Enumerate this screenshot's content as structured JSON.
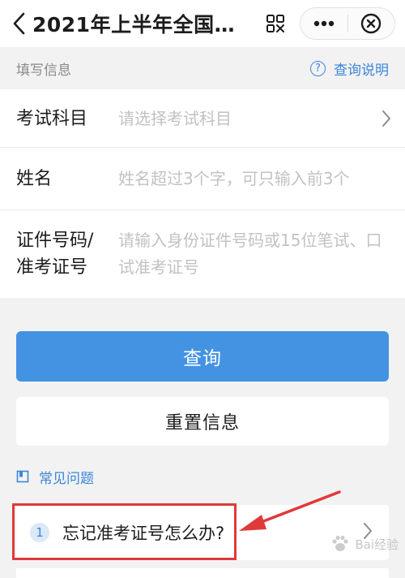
{
  "header": {
    "title": "2021年上半年全国…",
    "back_icon": "chevron-left-icon",
    "scan_icon": "scan-icon",
    "more_icon": "more-dots-icon",
    "close_icon": "close-circle-icon"
  },
  "section": {
    "title": "填写信息",
    "help_label": "查询说明",
    "help_icon_glyph": "?"
  },
  "form": {
    "subject": {
      "label": "考试科目",
      "placeholder": "请选择考试科目"
    },
    "name": {
      "label": "姓名",
      "placeholder": "姓名超过3个字，可只输入前3个"
    },
    "id_number": {
      "label_line1": "证件号码/",
      "label_line2": "准考证号",
      "placeholder": "请输入身份证件号码或15位笔试、口试准考证号"
    }
  },
  "buttons": {
    "query": "查询",
    "reset": "重置信息"
  },
  "faq": {
    "title": "常见问题",
    "items": [
      {
        "number": "1",
        "text": "忘记准考证号怎么办?"
      }
    ]
  },
  "annotation": {
    "highlight_color": "#e0393a"
  },
  "watermark": {
    "text": "Bai经验"
  },
  "colors": {
    "accent": "#3b86d9",
    "primary_button": "#4493e3",
    "background": "#f2f2f2",
    "placeholder": "#c2c2c2"
  }
}
